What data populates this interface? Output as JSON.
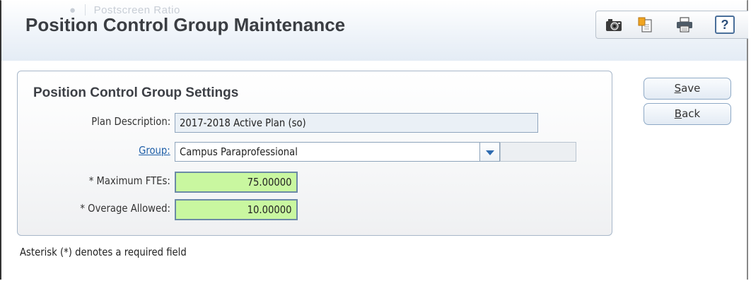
{
  "header": {
    "title": "Position Control Group Maintenance",
    "ghost_tab": "Postscreen Ratio"
  },
  "toolbar": {
    "icons": [
      "camera-icon",
      "copy-document-icon",
      "printer-icon",
      "help-icon"
    ],
    "help_label": "?"
  },
  "panel": {
    "title": "Position Control Group Settings",
    "plan_description": {
      "label": "Plan Description:",
      "value": "2017-2018 Active Plan (so)"
    },
    "group": {
      "label": "Group:",
      "value": "Campus Paraprofessional"
    },
    "maximum_ftes": {
      "label": "* Maximum FTEs:",
      "value": "75.00000"
    },
    "overage_allowed": {
      "label": "* Overage Allowed:",
      "value": "10.00000"
    }
  },
  "actions": {
    "save_access_key": "S",
    "save_rest": "ave",
    "back_access_key": "B",
    "back_rest": "ack"
  },
  "footer_note": "Asterisk (*) denotes a required field",
  "colors": {
    "required_field_bg": "#c9f7a0",
    "link": "#1f5fa8",
    "panel_border": "#a7b7c9"
  }
}
